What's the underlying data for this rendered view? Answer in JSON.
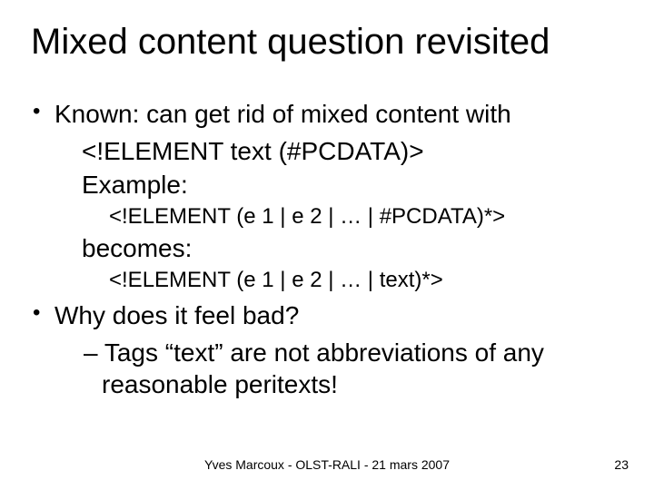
{
  "title": "Mixed content question revisited",
  "b1": "Known: can get rid of mixed content with",
  "l1a": "<!ELEMENT text (#PCDATA)>",
  "l1b": "Example:",
  "l1c": "<!ELEMENT (e 1 | e 2 | … | #PCDATA)*>",
  "l1d": "becomes:",
  "l1e": "<!ELEMENT (e 1 | e 2 | … | text)*>",
  "b2": "Why does it feel bad?",
  "s1": "Tags “text” are not abbreviations of any reasonable peritexts!",
  "footer_center": "Yves Marcoux - OLST-RALI - 21 mars 2007",
  "footer_right": "23"
}
